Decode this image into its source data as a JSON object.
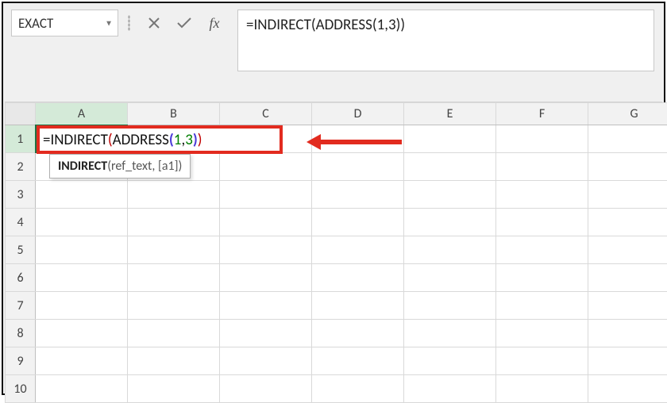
{
  "name_box": {
    "value": "EXACT"
  },
  "formula_bar": {
    "cancel_title": "Cancel",
    "enter_title": "Enter",
    "fx_label": "fx",
    "value": "=INDIRECT(ADDRESS(1,3))"
  },
  "columns": [
    "A",
    "B",
    "C",
    "D",
    "E",
    "F",
    "G"
  ],
  "rows": [
    "1",
    "2",
    "3",
    "4",
    "5",
    "6",
    "7",
    "8",
    "9",
    "10"
  ],
  "active": {
    "col": "A",
    "row": "1"
  },
  "cell_edit": {
    "eq": "=",
    "fn1": "INDIRECT",
    "p1o": "(",
    "fn2": "ADDRESS",
    "p2o": "(",
    "n1": "1",
    "comma": ",",
    "n2": "3",
    "p2c": ")",
    "p1c": ")"
  },
  "tooltip": {
    "fn": "INDIRECT",
    "args": "(ref_text, [a1])"
  }
}
